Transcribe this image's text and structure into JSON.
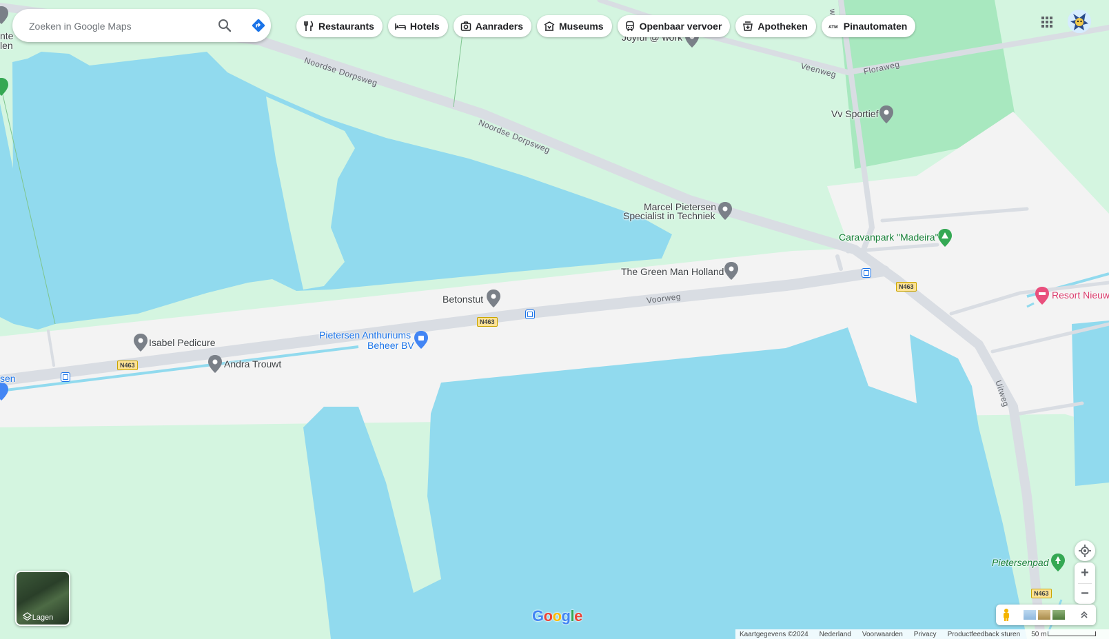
{
  "search": {
    "placeholder": "Zoeken in Google Maps"
  },
  "chips": [
    {
      "label": "Restaurants",
      "icon": "fork-knife-icon"
    },
    {
      "label": "Hotels",
      "icon": "bed-icon"
    },
    {
      "label": "Aanraders",
      "icon": "camera-icon"
    },
    {
      "label": "Museums",
      "icon": "museum-icon"
    },
    {
      "label": "Openbaar vervoer",
      "icon": "train-icon"
    },
    {
      "label": "Apotheken",
      "icon": "pharmacy-icon"
    },
    {
      "label": "Pinautomaten",
      "icon": "atm-icon"
    }
  ],
  "places": {
    "marcel_line1": "Marcel Pietersen",
    "marcel_line2": "Specialist in Techniek",
    "green_man": "The Green Man Holland",
    "betonstut": "Betonstut",
    "isabel": "Isabel Pedicure",
    "andra": "Andra Trouwt",
    "anthuriums_line1": "Pietersen Anthuriums",
    "anthuriums_line2": "Beheer BV",
    "sportief": "Vv Sportief",
    "caravanpark": "Caravanpark \"Madeira\"",
    "resort": "Resort Nieuw",
    "pietersenpad": "Pietersenpad",
    "joyful": "Joyful @ work",
    "left_partial_1": "nte",
    "left_partial_2": "len",
    "left_partial_3": "sen"
  },
  "roads": {
    "noordse_1": "Noordse Dorpsweg",
    "noordse_2": "Noordse Dorpsweg",
    "voorweg": "Voorweg",
    "veenweg": "Veenweg",
    "floraweg": "Floraweg",
    "uitweg": "Uitweg",
    "top_partial": "weg"
  },
  "shields": {
    "n463": "N463"
  },
  "layers": {
    "label": "Lagen"
  },
  "logo": {
    "text": "Google"
  },
  "footer": {
    "copyright": "Kaartgegevens ©2024",
    "country": "Nederland",
    "terms": "Voorwaarden",
    "privacy": "Privacy",
    "feedback": "Productfeedback sturen",
    "scale": "50 m"
  },
  "colors": {
    "water": "#91daee",
    "land": "#d4f5e0",
    "urban": "#f3f3f3",
    "road": "#d9dde3",
    "park": "#a8e8bf"
  }
}
